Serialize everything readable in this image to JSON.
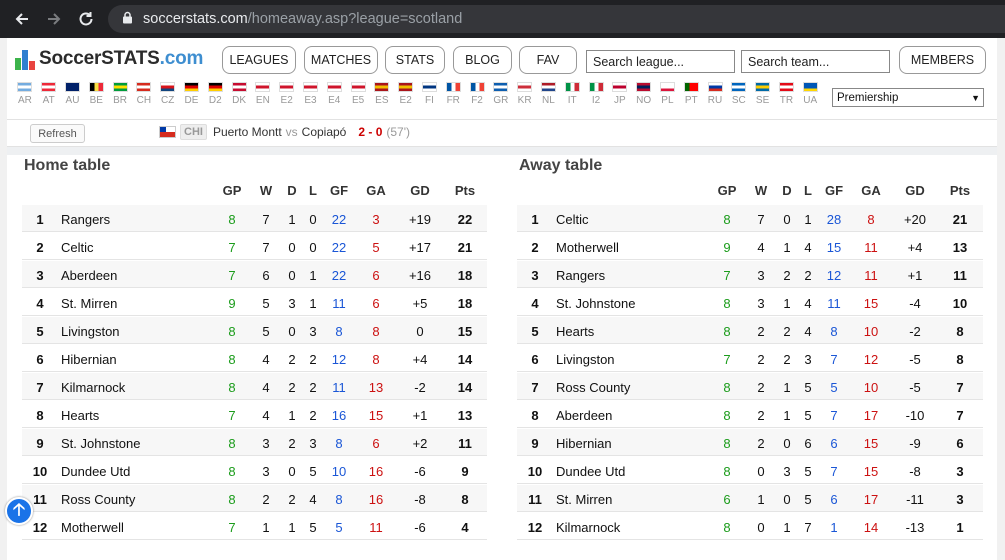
{
  "browser": {
    "url_host": "soccerstats.com",
    "url_path": "/homeaway.asp?league=scotland"
  },
  "site": {
    "logo_main": "SoccerSTATS",
    "logo_domain": ".com",
    "nav": [
      "LEAGUES",
      "MATCHES",
      "STATS",
      "BLOG",
      "FAV"
    ],
    "search_league_placeholder": "Search league...",
    "search_team_placeholder": "Search team...",
    "members_label": "MEMBERS",
    "league_select": "Premiership"
  },
  "flags": [
    {
      "code": "AR",
      "colors": [
        "#74acdf",
        "#ffffff",
        "#74acdf"
      ]
    },
    {
      "code": "AT",
      "colors": [
        "#ed2939",
        "#ffffff",
        "#ed2939"
      ]
    },
    {
      "code": "AU",
      "colors": [
        "#012169",
        "#012169",
        "#012169"
      ]
    },
    {
      "code": "BE",
      "colors": [
        "#000000",
        "#fae042",
        "#ed2939"
      ],
      "vertical": true
    },
    {
      "code": "BR",
      "colors": [
        "#009c3b",
        "#ffdf00",
        "#009c3b"
      ]
    },
    {
      "code": "CH",
      "colors": [
        "#d52b1e",
        "#ffffff",
        "#d52b1e"
      ]
    },
    {
      "code": "CZ",
      "colors": [
        "#ffffff",
        "#d7141a",
        "#11457e"
      ]
    },
    {
      "code": "DE",
      "colors": [
        "#000000",
        "#dd0000",
        "#ffce00"
      ]
    },
    {
      "code": "D2",
      "colors": [
        "#000000",
        "#dd0000",
        "#ffce00"
      ]
    },
    {
      "code": "DK",
      "colors": [
        "#c60c30",
        "#ffffff",
        "#c60c30"
      ]
    },
    {
      "code": "EN",
      "colors": [
        "#ffffff",
        "#cf142b",
        "#ffffff"
      ]
    },
    {
      "code": "E2",
      "colors": [
        "#ffffff",
        "#cf142b",
        "#ffffff"
      ]
    },
    {
      "code": "E3",
      "colors": [
        "#ffffff",
        "#cf142b",
        "#ffffff"
      ]
    },
    {
      "code": "E4",
      "colors": [
        "#ffffff",
        "#cf142b",
        "#ffffff"
      ]
    },
    {
      "code": "E5",
      "colors": [
        "#ffffff",
        "#cf142b",
        "#ffffff"
      ]
    },
    {
      "code": "ES",
      "colors": [
        "#aa151b",
        "#f1bf00",
        "#aa151b"
      ]
    },
    {
      "code": "E2",
      "colors": [
        "#aa151b",
        "#f1bf00",
        "#aa151b"
      ]
    },
    {
      "code": "FI",
      "colors": [
        "#ffffff",
        "#003580",
        "#ffffff"
      ]
    },
    {
      "code": "FR",
      "colors": [
        "#0055a4",
        "#ffffff",
        "#ef4135"
      ],
      "vertical": true
    },
    {
      "code": "F2",
      "colors": [
        "#0055a4",
        "#ffffff",
        "#ef4135"
      ],
      "vertical": true
    },
    {
      "code": "GR",
      "colors": [
        "#0d5eaf",
        "#ffffff",
        "#0d5eaf"
      ]
    },
    {
      "code": "KR",
      "colors": [
        "#ffffff",
        "#cd2e3a",
        "#ffffff"
      ]
    },
    {
      "code": "NL",
      "colors": [
        "#ae1c28",
        "#ffffff",
        "#21468b"
      ]
    },
    {
      "code": "IT",
      "colors": [
        "#009246",
        "#ffffff",
        "#ce2b37"
      ],
      "vertical": true
    },
    {
      "code": "I2",
      "colors": [
        "#009246",
        "#ffffff",
        "#ce2b37"
      ],
      "vertical": true
    },
    {
      "code": "JP",
      "colors": [
        "#ffffff",
        "#bc002d",
        "#ffffff"
      ]
    },
    {
      "code": "NO",
      "colors": [
        "#ba0c2f",
        "#00205b",
        "#ba0c2f"
      ]
    },
    {
      "code": "PL",
      "colors": [
        "#ffffff",
        "#ffffff",
        "#dc143c"
      ]
    },
    {
      "code": "PT",
      "colors": [
        "#006600",
        "#ff0000",
        "#ff0000"
      ],
      "vertical": true
    },
    {
      "code": "RU",
      "colors": [
        "#ffffff",
        "#0039a6",
        "#d52b1e"
      ]
    },
    {
      "code": "SC",
      "colors": [
        "#0065bd",
        "#ffffff",
        "#0065bd"
      ]
    },
    {
      "code": "SE",
      "colors": [
        "#006aa7",
        "#fecc00",
        "#006aa7"
      ]
    },
    {
      "code": "TR",
      "colors": [
        "#e30a17",
        "#ffffff",
        "#e30a17"
      ]
    },
    {
      "code": "UA",
      "colors": [
        "#0057b7",
        "#0057b7",
        "#ffd700"
      ]
    }
  ],
  "live": {
    "refresh_label": "Refresh",
    "country": "CHI",
    "home": "Puerto Montt",
    "vs": "vs",
    "away": "Copiapó",
    "score": "2 - 0",
    "minute": "(57')"
  },
  "columns": [
    "GP",
    "W",
    "D",
    "L",
    "GF",
    "GA",
    "GD",
    "Pts"
  ],
  "home_table": {
    "title": "Home table",
    "rows": [
      {
        "pos": "1",
        "team": "Rangers",
        "gp": "8",
        "w": "7",
        "d": "1",
        "l": "0",
        "gf": "22",
        "ga": "3",
        "gd": "+19",
        "pts": "22"
      },
      {
        "pos": "2",
        "team": "Celtic",
        "gp": "7",
        "w": "7",
        "d": "0",
        "l": "0",
        "gf": "22",
        "ga": "5",
        "gd": "+17",
        "pts": "21"
      },
      {
        "pos": "3",
        "team": "Aberdeen",
        "gp": "7",
        "w": "6",
        "d": "0",
        "l": "1",
        "gf": "22",
        "ga": "6",
        "gd": "+16",
        "pts": "18"
      },
      {
        "pos": "4",
        "team": "St. Mirren",
        "gp": "9",
        "w": "5",
        "d": "3",
        "l": "1",
        "gf": "11",
        "ga": "6",
        "gd": "+5",
        "pts": "18"
      },
      {
        "pos": "5",
        "team": "Livingston",
        "gp": "8",
        "w": "5",
        "d": "0",
        "l": "3",
        "gf": "8",
        "ga": "8",
        "gd": "0",
        "pts": "15"
      },
      {
        "pos": "6",
        "team": "Hibernian",
        "gp": "8",
        "w": "4",
        "d": "2",
        "l": "2",
        "gf": "12",
        "ga": "8",
        "gd": "+4",
        "pts": "14"
      },
      {
        "pos": "7",
        "team": "Kilmarnock",
        "gp": "8",
        "w": "4",
        "d": "2",
        "l": "2",
        "gf": "11",
        "ga": "13",
        "gd": "-2",
        "pts": "14"
      },
      {
        "pos": "8",
        "team": "Hearts",
        "gp": "7",
        "w": "4",
        "d": "1",
        "l": "2",
        "gf": "16",
        "ga": "15",
        "gd": "+1",
        "pts": "13"
      },
      {
        "pos": "9",
        "team": "St. Johnstone",
        "gp": "8",
        "w": "3",
        "d": "2",
        "l": "3",
        "gf": "8",
        "ga": "6",
        "gd": "+2",
        "pts": "11"
      },
      {
        "pos": "10",
        "team": "Dundee Utd",
        "gp": "8",
        "w": "3",
        "d": "0",
        "l": "5",
        "gf": "10",
        "ga": "16",
        "gd": "-6",
        "pts": "9"
      },
      {
        "pos": "11",
        "team": "Ross County",
        "gp": "8",
        "w": "2",
        "d": "2",
        "l": "4",
        "gf": "8",
        "ga": "16",
        "gd": "-8",
        "pts": "8"
      },
      {
        "pos": "12",
        "team": "Motherwell",
        "gp": "7",
        "w": "1",
        "d": "1",
        "l": "5",
        "gf": "5",
        "ga": "11",
        "gd": "-6",
        "pts": "4"
      }
    ]
  },
  "away_table": {
    "title": "Away table",
    "rows": [
      {
        "pos": "1",
        "team": "Celtic",
        "gp": "8",
        "w": "7",
        "d": "0",
        "l": "1",
        "gf": "28",
        "ga": "8",
        "gd": "+20",
        "pts": "21"
      },
      {
        "pos": "2",
        "team": "Motherwell",
        "gp": "9",
        "w": "4",
        "d": "1",
        "l": "4",
        "gf": "15",
        "ga": "11",
        "gd": "+4",
        "pts": "13"
      },
      {
        "pos": "3",
        "team": "Rangers",
        "gp": "7",
        "w": "3",
        "d": "2",
        "l": "2",
        "gf": "12",
        "ga": "11",
        "gd": "+1",
        "pts": "11"
      },
      {
        "pos": "4",
        "team": "St. Johnstone",
        "gp": "8",
        "w": "3",
        "d": "1",
        "l": "4",
        "gf": "11",
        "ga": "15",
        "gd": "-4",
        "pts": "10"
      },
      {
        "pos": "5",
        "team": "Hearts",
        "gp": "8",
        "w": "2",
        "d": "2",
        "l": "4",
        "gf": "8",
        "ga": "10",
        "gd": "-2",
        "pts": "8"
      },
      {
        "pos": "6",
        "team": "Livingston",
        "gp": "7",
        "w": "2",
        "d": "2",
        "l": "3",
        "gf": "7",
        "ga": "12",
        "gd": "-5",
        "pts": "8"
      },
      {
        "pos": "7",
        "team": "Ross County",
        "gp": "8",
        "w": "2",
        "d": "1",
        "l": "5",
        "gf": "5",
        "ga": "10",
        "gd": "-5",
        "pts": "7"
      },
      {
        "pos": "8",
        "team": "Aberdeen",
        "gp": "8",
        "w": "2",
        "d": "1",
        "l": "5",
        "gf": "7",
        "ga": "17",
        "gd": "-10",
        "pts": "7"
      },
      {
        "pos": "9",
        "team": "Hibernian",
        "gp": "8",
        "w": "2",
        "d": "0",
        "l": "6",
        "gf": "6",
        "ga": "15",
        "gd": "-9",
        "pts": "6"
      },
      {
        "pos": "10",
        "team": "Dundee Utd",
        "gp": "8",
        "w": "0",
        "d": "3",
        "l": "5",
        "gf": "7",
        "ga": "15",
        "gd": "-8",
        "pts": "3"
      },
      {
        "pos": "11",
        "team": "St. Mirren",
        "gp": "6",
        "w": "1",
        "d": "0",
        "l": "5",
        "gf": "6",
        "ga": "17",
        "gd": "-11",
        "pts": "3"
      },
      {
        "pos": "12",
        "team": "Kilmarnock",
        "gp": "8",
        "w": "0",
        "d": "1",
        "l": "7",
        "gf": "1",
        "ga": "14",
        "gd": "-13",
        "pts": "1"
      }
    ]
  },
  "colors": {
    "gp": "#1b9c1b",
    "gf": "#1a56d6",
    "ga": "#cc1111",
    "row_stripe": "#f7f7f7",
    "logo_bar_green": "#3cb44b",
    "logo_bar_blue": "#2f7fd0",
    "logo_bar_red": "#e8433f"
  }
}
